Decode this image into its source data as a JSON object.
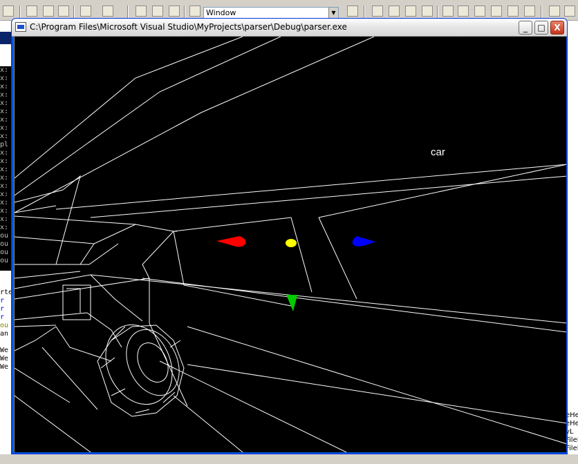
{
  "ide": {
    "toolbar": {
      "window_combo_value": "Window"
    },
    "output_lines": [
      "x:",
      "x:",
      "x:",
      "x:",
      "x:",
      "x:",
      "x:",
      "x:",
      "x:",
      "pl",
      "x:",
      "x:",
      "x:",
      "x:",
      "x:",
      "x:",
      "x:",
      "x:",
      "x:",
      "x:",
      "ou",
      "ou",
      "ou",
      "ou"
    ],
    "code_lines": [
      {
        "text": "rte",
        "color": "#000000"
      },
      {
        "text": "r",
        "color": "#0000ff"
      },
      {
        "text": "r",
        "color": "#0000ff"
      },
      {
        "text": "r",
        "color": "#0000ff"
      },
      {
        "text": "ou",
        "color": "#808000"
      },
      {
        "text": "an",
        "color": "#000000"
      },
      {
        "text": "",
        "color": "#000000"
      },
      {
        "text": "We",
        "color": "#000000"
      },
      {
        "text": "We",
        "color": "#000000"
      },
      {
        "text": "We",
        "color": "#000000"
      }
    ],
    "right_tree_items": [
      "eHe",
      "eHe",
      "yL",
      "FileRe",
      "FileR"
    ]
  },
  "window": {
    "title": "C:\\Program Files\\Microsoft Visual Studio\\MyProjects\\parser\\Debug\\parser.exe",
    "minimize_label": "_",
    "maximize_label": "□",
    "close_label": "X"
  },
  "scene": {
    "label": "car",
    "background": "#000000",
    "wire_color": "#ffffff",
    "markers": [
      {
        "name": "red-marker",
        "color": "#ff0000"
      },
      {
        "name": "yellow-marker",
        "color": "#ffff00"
      },
      {
        "name": "blue-marker",
        "color": "#0000ff"
      },
      {
        "name": "green-marker",
        "color": "#00cc00"
      }
    ]
  }
}
